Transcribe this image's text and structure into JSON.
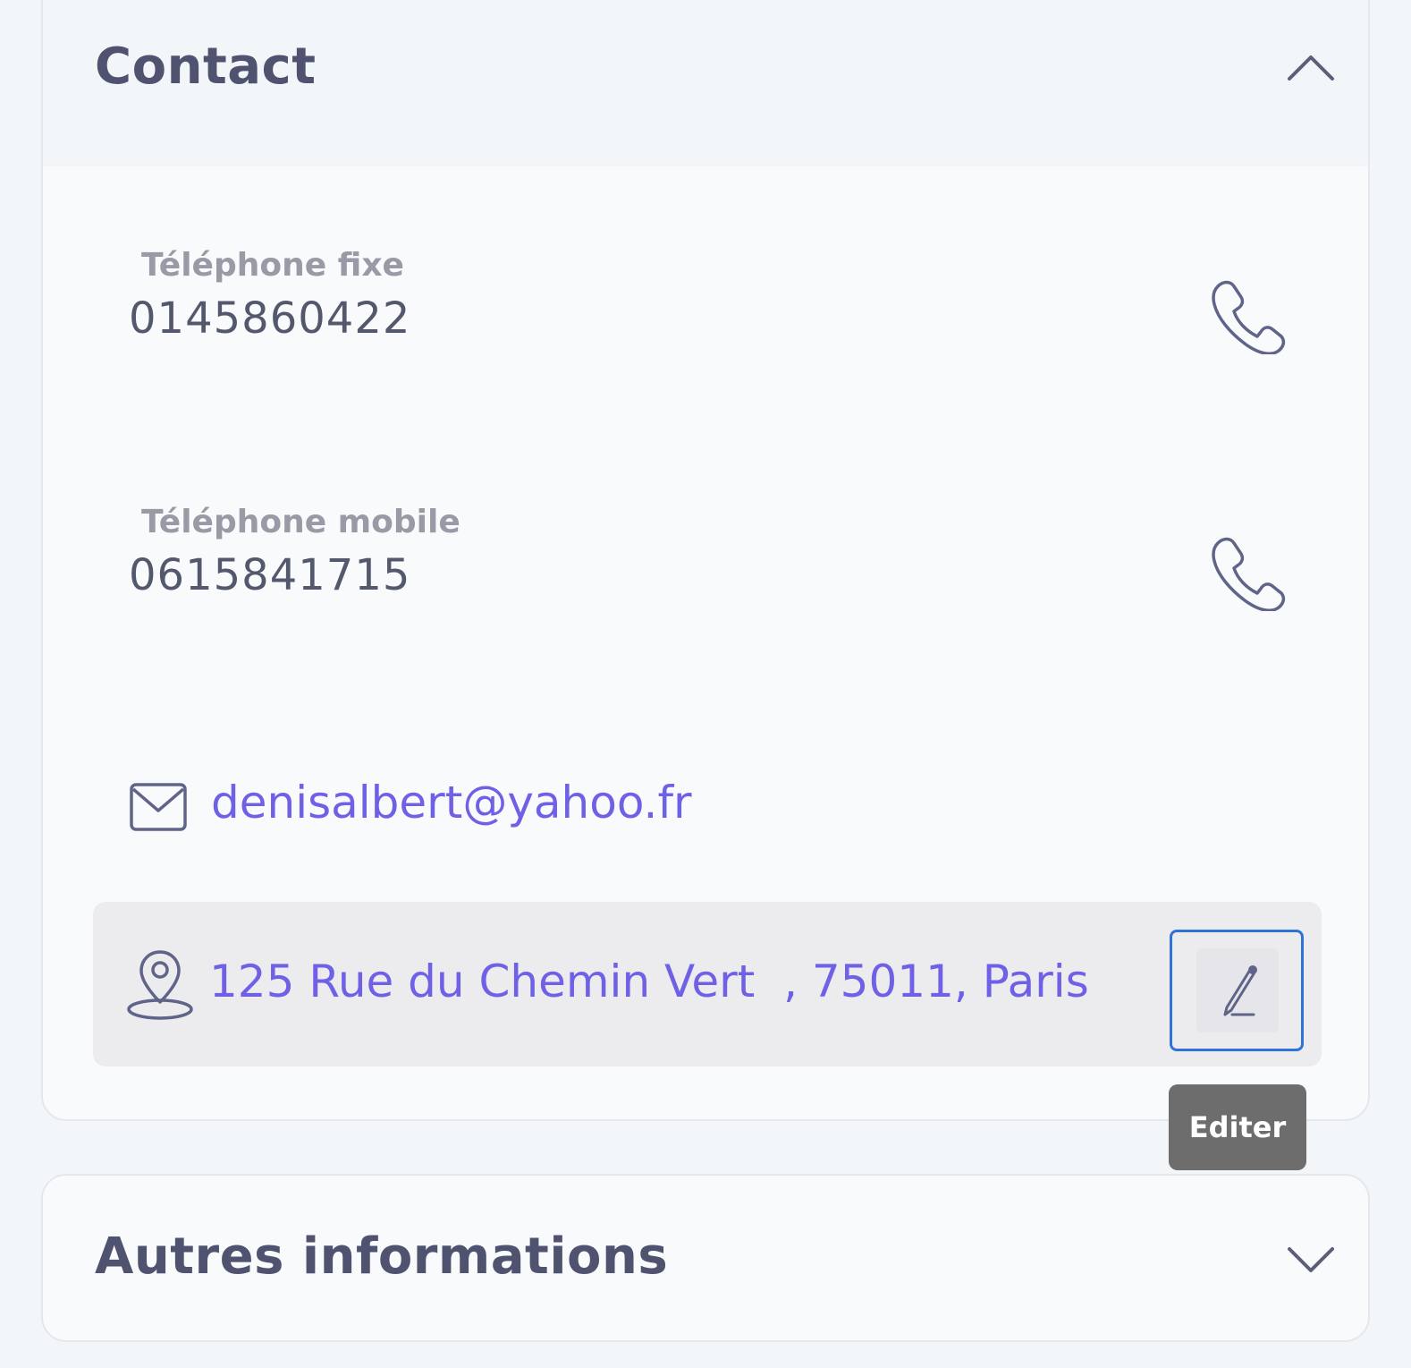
{
  "contact_section": {
    "title": "Contact",
    "expanded": true,
    "fixed_phone": {
      "label": "Téléphone fixe",
      "value": "0145860422",
      "icon": "phone-icon"
    },
    "mobile_phone": {
      "label": "Téléphone mobile",
      "value": "0615841715",
      "icon": "phone-icon"
    },
    "email": {
      "icon": "mail-icon",
      "value": "denisalbert@yahoo.fr"
    },
    "address": {
      "icon": "map-pin-icon",
      "value": "125 Rue du Chemin Vert  , 75011, Paris",
      "edit_icon": "pencil-icon",
      "edit_tooltip": "Editer"
    }
  },
  "other_section": {
    "title": "Autres informations",
    "expanded": false
  },
  "colors": {
    "accent": "#6f61e6",
    "heading": "#4f5370",
    "focus": "#2f73d8",
    "tooltip_bg": "#6d6d6d"
  }
}
